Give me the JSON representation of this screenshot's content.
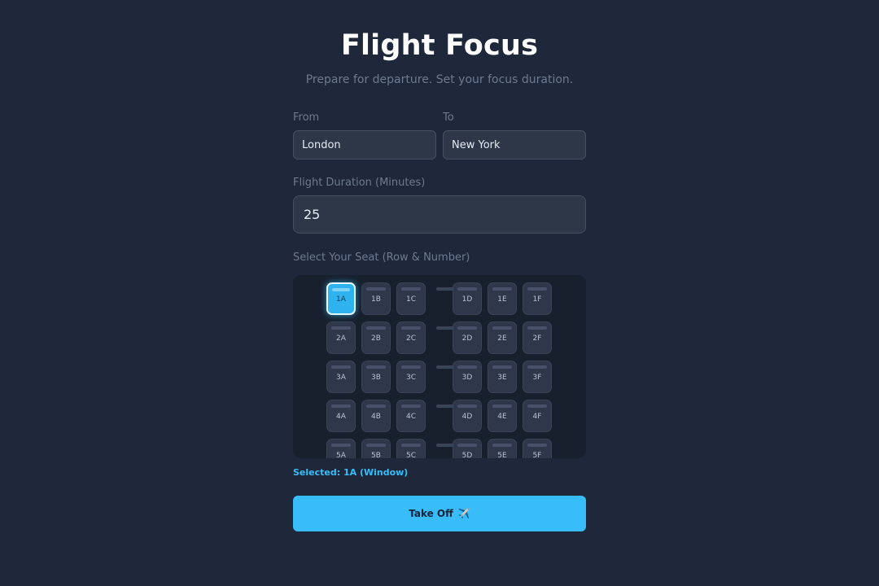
{
  "header": {
    "title": "Flight Focus",
    "subtitle": "Prepare for departure. Set your focus duration."
  },
  "route": {
    "from_label": "From",
    "from_value": "London",
    "to_label": "To",
    "to_value": "New York"
  },
  "duration": {
    "label": "Flight Duration (Minutes)",
    "value": "25"
  },
  "seats": {
    "label": "Select Your Seat (Row & Number)",
    "rows": [
      [
        "1A",
        "1B",
        "1C",
        "1D",
        "1E",
        "1F"
      ],
      [
        "2A",
        "2B",
        "2C",
        "2D",
        "2E",
        "2F"
      ],
      [
        "3A",
        "3B",
        "3C",
        "3D",
        "3E",
        "3F"
      ],
      [
        "4A",
        "4B",
        "4C",
        "4D",
        "4E",
        "4F"
      ],
      [
        "5A",
        "5B",
        "5C",
        "5D",
        "5E",
        "5F"
      ]
    ],
    "selected": "1A",
    "selected_text": "Selected: 1A (Window)"
  },
  "action": {
    "takeoff_label": "Take Off",
    "takeoff_icon": "✈️"
  },
  "colors": {
    "accent": "#38bdf8",
    "background": "#1f283a"
  }
}
